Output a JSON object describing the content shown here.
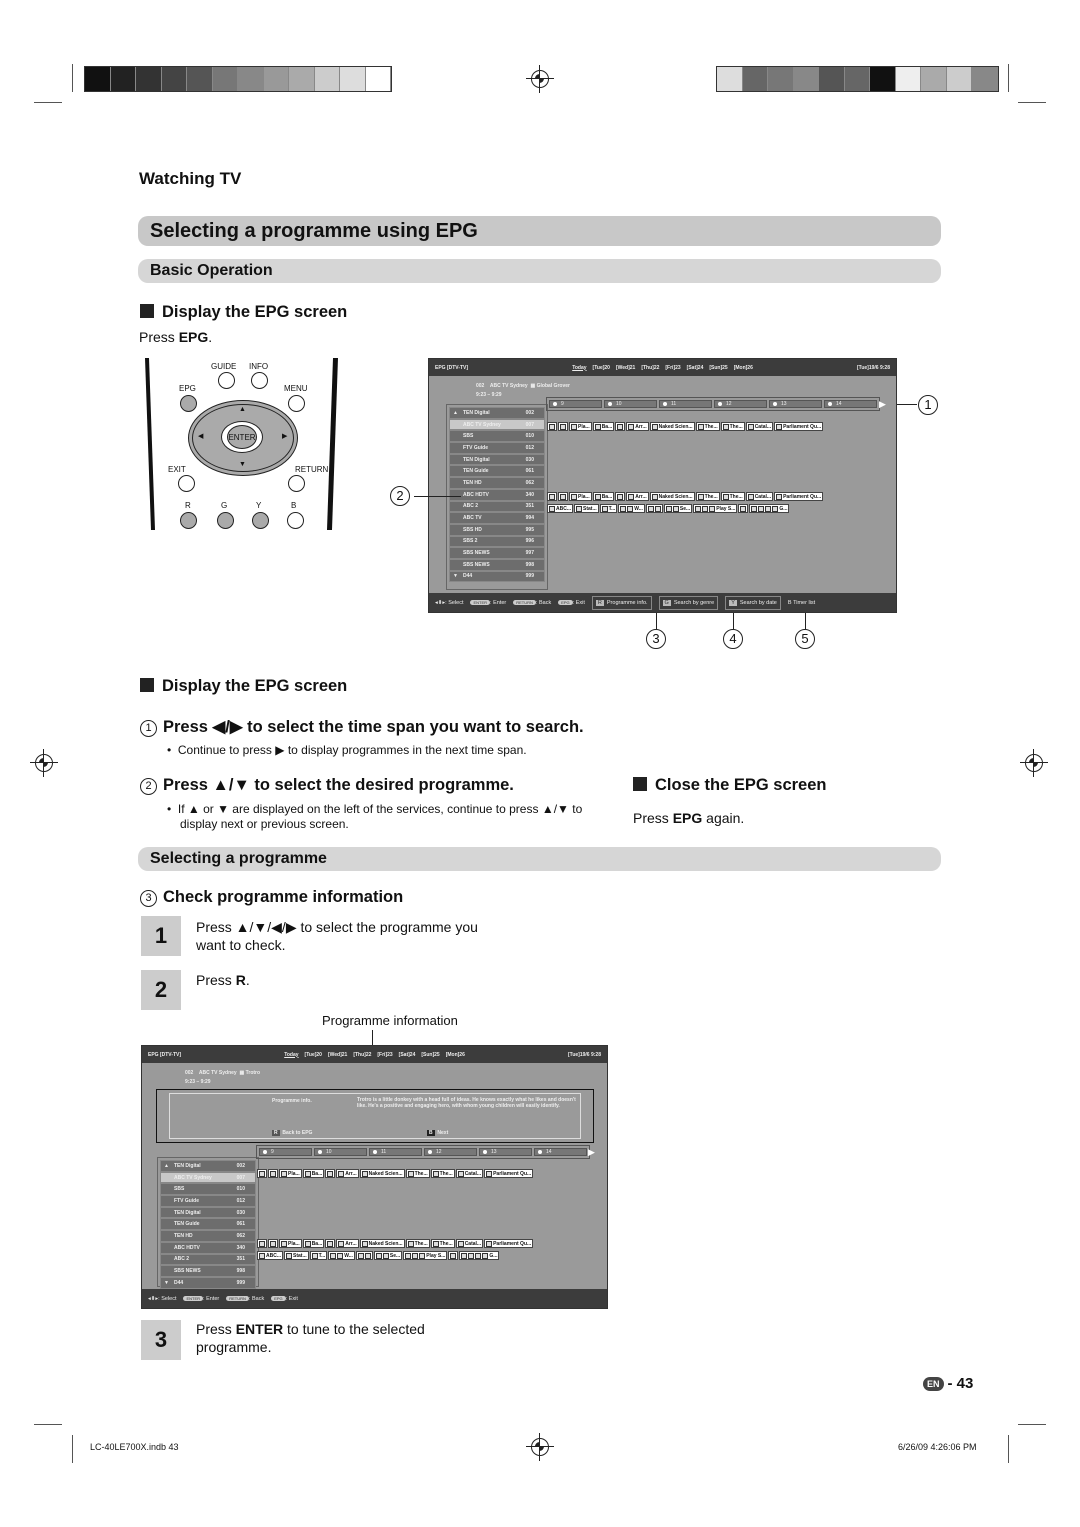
{
  "section": "Watching TV",
  "title": "Selecting a programme using EPG",
  "basic_operation": "Basic Operation",
  "display_heading": "Display the EPG screen",
  "press_epg": {
    "pre": "Press ",
    "key": "EPG",
    "post": "."
  },
  "remote": {
    "guide": "GUIDE",
    "info": "INFO",
    "epg": "EPG",
    "menu": "MENU",
    "enter": "ENTER",
    "exit": "EXIT",
    "return": "RETURN",
    "r": "R",
    "g": "G",
    "y": "Y",
    "b": "B"
  },
  "callouts": {
    "c1": "1",
    "c2": "2",
    "c3": "3",
    "c4": "4",
    "c5": "5"
  },
  "epg1": {
    "title": "EPG [DTV-TV]",
    "days": [
      "Today",
      "[Tue]20",
      "[Wed]21",
      "[Thu]22",
      "[Fri]23",
      "[Sat]24",
      "[Sun]25",
      "[Mon]26"
    ],
    "clock": "[Tue]19/6  9:28",
    "cur_num": "002",
    "cur_channel": "ABC TV Sydney",
    "cur_programme": "Global Grover",
    "cur_time": "9:23 – 9:29",
    "slots": [
      "9",
      "10",
      "11",
      "12",
      "13",
      "14"
    ],
    "channels": [
      {
        "name": "TEN Digital",
        "num": "002",
        "arrow": "▲"
      },
      {
        "name": "ABC TV Sydney",
        "num": "007",
        "selected": true
      },
      {
        "name": "SBS",
        "num": "010"
      },
      {
        "name": "FTV Guide",
        "num": "012"
      },
      {
        "name": "TEN Digital",
        "num": "030"
      },
      {
        "name": "TEN Guide",
        "num": "061"
      },
      {
        "name": "TEN HD",
        "num": "062"
      },
      {
        "name": "ABC HDTV",
        "num": "340"
      },
      {
        "name": "ABC 2",
        "num": "351"
      },
      {
        "name": "ABC TV",
        "num": "994"
      },
      {
        "name": "SBS HD",
        "num": "995"
      },
      {
        "name": "SBS 2",
        "num": "996"
      },
      {
        "name": "SBS NEWS",
        "num": "997"
      },
      {
        "name": "SBS NEWS",
        "num": "998"
      },
      {
        "name": "D44",
        "num": "999",
        "arrow": "▼"
      }
    ],
    "footer": {
      "select": ": Select",
      "enter_key": "ENTER",
      "enter": ": Enter",
      "return_key": "RETURN",
      "back": ": Back",
      "epg_key": "EPG",
      "exit": ": Exit",
      "r": "R",
      "r_label": "Programme info.",
      "g": "G",
      "g_label": "Search by genre",
      "y": "Y",
      "y_label": "Search by date",
      "b": "B",
      "b_label": "Timer list"
    }
  },
  "programme_rows": {
    "a": [
      {
        "i": 1,
        "t": ""
      },
      {
        "i": 1,
        "t": ""
      },
      {
        "i": 1,
        "t": "Pla..."
      },
      {
        "i": 1,
        "t": "Ba..."
      },
      {
        "i": 1,
        "t": ""
      },
      {
        "i": 1,
        "t": "Arr..."
      },
      {
        "i": 1,
        "t": "Naked Scien..."
      },
      {
        "i": 1,
        "t": "The..."
      },
      {
        "i": 1,
        "t": "The..."
      },
      {
        "i": 1,
        "t": "Catal..."
      },
      {
        "i": 1,
        "t": "Parliament Qu..."
      }
    ],
    "b": [
      {
        "i": 1,
        "t": "ABC..."
      },
      {
        "i": 1,
        "t": "Stat..."
      },
      {
        "i": 1,
        "t": "T..."
      },
      {
        "i": 2,
        "t": "W..."
      },
      {
        "i": 2,
        "t": ""
      },
      {
        "i": 2,
        "t": "Se..."
      },
      {
        "i": 3,
        "t": "Play S..."
      },
      {
        "i": 1,
        "t": ""
      },
      {
        "i": 4,
        "t": "G..."
      }
    ]
  },
  "step_display": {
    "heading": "Display the EPG screen"
  },
  "step1": {
    "pre": "Press ",
    "keys": "◀/▶",
    "post": " to select the time span you want to search.",
    "bullet": "Continue to press ▶ to display programmes in the next time span."
  },
  "step2": {
    "pre": "Press ",
    "keys": "▲/▼",
    "post": " to select the desired programme.",
    "bullet": "If ▲ or ▼ are displayed on the left of the services, continue to press ▲/▼ to display next or previous screen."
  },
  "close": {
    "heading": "Close the EPG screen",
    "pre": "Press ",
    "key": "EPG",
    "post": " again."
  },
  "selecting": "Selecting a programme",
  "step3": {
    "heading": "Check programme information"
  },
  "steps": [
    {
      "n": "1",
      "text": "Press ▲/▼/◀/▶ to select the programme you want to check."
    },
    {
      "n": "2",
      "pre": "Press ",
      "key": "R",
      "post": "."
    },
    {
      "n": "3",
      "pre": "Press ",
      "key": "ENTER",
      "post": " to tune to the selected programme."
    }
  ],
  "prog_info_label": "Programme information",
  "epg2": {
    "title": "EPG [DTV-TV]",
    "days": [
      "Today",
      "[Tue]20",
      "[Wed]21",
      "[Thu]22",
      "[Fri]23",
      "[Sat]24",
      "[Sun]25",
      "[Mon]26"
    ],
    "clock": "[Tue]19/6  9:28",
    "cur_num": "002",
    "cur_channel": "ABC TV Sydney",
    "cur_programme": "Trotro",
    "cur_time": "9:23 – 9:29",
    "info_label": "Programme info.",
    "info_text": "Trotro is a little donkey with a head full of ideas. He knows exactly what he likes and doesn't like. He's a positive and engaging hero, with whom young children will easily identify.",
    "r": "R",
    "r_label": "Back to EPG",
    "b": "B",
    "b_label": "Next",
    "slots": [
      "9",
      "10",
      "11",
      "12",
      "13",
      "14"
    ],
    "channels": [
      {
        "name": "TEN Digital",
        "num": "002",
        "arrow": "▲"
      },
      {
        "name": "ABC TV Sydney",
        "num": "007",
        "selected": true
      },
      {
        "name": "SBS",
        "num": "010"
      },
      {
        "name": "FTV Guide",
        "num": "012"
      },
      {
        "name": "TEN Digital",
        "num": "030"
      },
      {
        "name": "TEN Guide",
        "num": "061"
      },
      {
        "name": "TEN HD",
        "num": "062"
      },
      {
        "name": "ABC HDTV",
        "num": "340"
      },
      {
        "name": "ABC 2",
        "num": "351"
      },
      {
        "name": "SBS NEWS",
        "num": "998"
      },
      {
        "name": "D44",
        "num": "999",
        "arrow": "▼"
      }
    ],
    "footer": {
      "select": ": Select",
      "enter_key": "ENTER",
      "enter": ": Enter",
      "return_key": "RETURN",
      "back": ": Back",
      "epg_key": "EPG",
      "exit": ": Exit"
    }
  },
  "page": {
    "lang": "EN",
    "number": "- 43"
  },
  "slug": {
    "file": "LC-40LE700X.indb   43",
    "date": "6/26/09   4:26:06 PM"
  },
  "regbar_left": [
    "#111",
    "#222",
    "#333",
    "#444",
    "#555",
    "#777",
    "#888",
    "#999",
    "#aaa",
    "#ccc",
    "#ddd",
    "#fff"
  ],
  "regbar_right": [
    "#ddd",
    "#666",
    "#777",
    "#888",
    "#555",
    "#666",
    "#111",
    "#eee",
    "#aaa",
    "#ccc",
    "#888"
  ]
}
